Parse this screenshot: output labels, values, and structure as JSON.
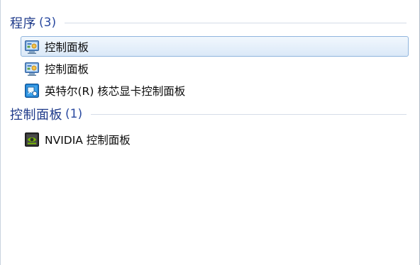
{
  "groups": {
    "programs": {
      "title": "程序",
      "count": "(3)",
      "items": [
        {
          "label": "控制面板",
          "icon": "control-panel-icon",
          "selected": true
        },
        {
          "label": "控制面板",
          "icon": "control-panel-icon",
          "selected": false
        },
        {
          "label": "英特尔(R) 核芯显卡控制面板",
          "icon": "intel-graphics-icon",
          "selected": false
        }
      ]
    },
    "control_panel": {
      "title": "控制面板",
      "count": "(1)",
      "items": [
        {
          "label": "NVIDIA 控制面板",
          "icon": "nvidia-control-panel-icon",
          "selected": false
        }
      ]
    }
  },
  "colors": {
    "header_text": "#1e3a8a",
    "selection_border": "#8fb4dd",
    "selection_fill": "#dbe9f8"
  }
}
